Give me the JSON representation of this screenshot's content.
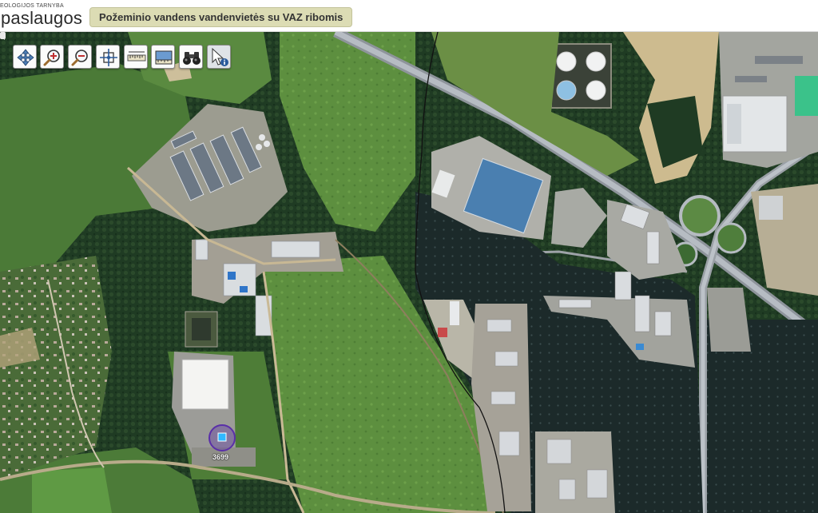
{
  "header": {
    "logo_small_text": "EOLOGIJOS TARNYBA",
    "logo_text": "paslaugos",
    "layer_title": "Požeminio vandens vandenvietės su VAZ ribomis"
  },
  "toolbar": {
    "tools": [
      {
        "name": "pan",
        "icon": "pan-arrows-icon"
      },
      {
        "name": "zoom-in",
        "icon": "zoom-in-icon"
      },
      {
        "name": "zoom-out",
        "icon": "zoom-out-icon"
      },
      {
        "name": "full-extent",
        "icon": "full-extent-icon"
      },
      {
        "name": "measure-distance",
        "icon": "ruler-icon"
      },
      {
        "name": "measure-area",
        "icon": "area-ruler-icon"
      },
      {
        "name": "find",
        "icon": "binoculars-icon"
      },
      {
        "name": "identify",
        "icon": "identify-cursor-icon"
      }
    ]
  },
  "map": {
    "well_marker": {
      "label": "3699",
      "color": "#2fb8ff",
      "ring_color": "#5a2fa8"
    }
  }
}
